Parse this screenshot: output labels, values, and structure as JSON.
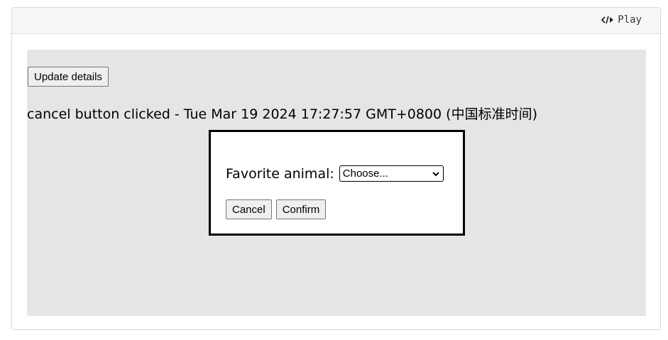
{
  "toolbar": {
    "play_label": "Play",
    "play_icon": "code-icon"
  },
  "stage": {
    "update_button_label": "Update details",
    "status_text": "cancel button clicked - Tue Mar 19 2024 17:27:57 GMT+0800 (中国标准时间)"
  },
  "dialog": {
    "field_label": "Favorite animal:",
    "select_value": "Choose...",
    "cancel_label": "Cancel",
    "confirm_label": "Confirm"
  },
  "colors": {
    "stage_bg": "#e5e5e5",
    "toolbar_bg": "#f7f7f8",
    "dialog_border": "#000000"
  }
}
